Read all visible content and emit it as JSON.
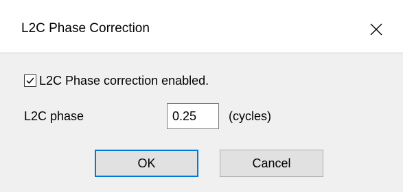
{
  "window": {
    "title": "L2C Phase Correction",
    "close_icon": "close-icon"
  },
  "options": {
    "enabled_checked": true,
    "enabled_label": "L2C Phase correction enabled.",
    "phase_label": "L2C phase",
    "phase_value": "0.25",
    "phase_units": "(cycles)"
  },
  "buttons": {
    "ok_label": "OK",
    "cancel_label": "Cancel"
  },
  "colors": {
    "focus_border": "#0078d7",
    "client_background": "#f0f0f0",
    "button_face": "#e1e1e1"
  }
}
